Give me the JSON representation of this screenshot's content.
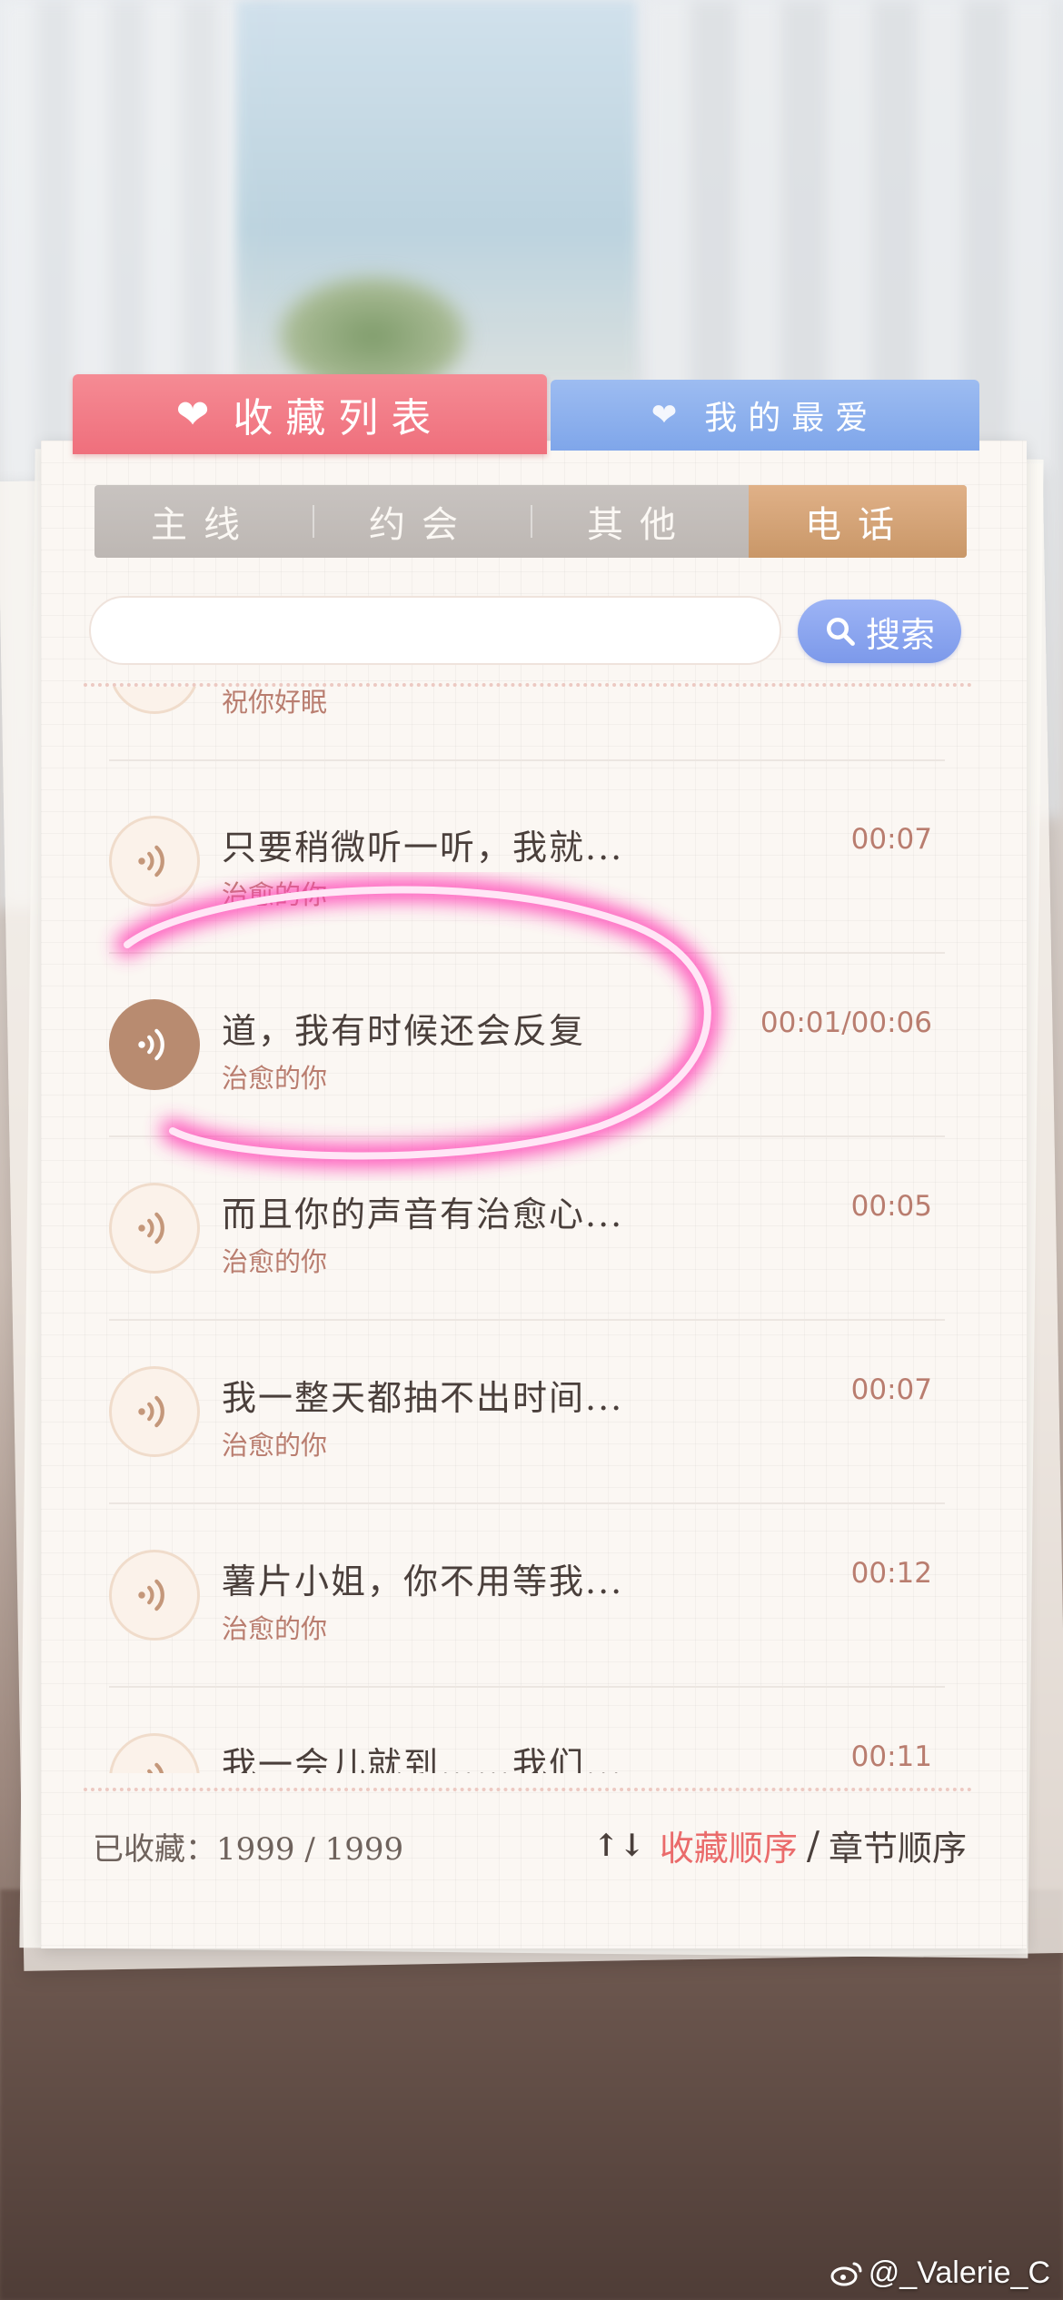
{
  "tabs": {
    "favorites": "收藏列表",
    "my_love": "我的最爱"
  },
  "categories": [
    "主线",
    "约会",
    "其他",
    "电话"
  ],
  "active_category": "电话",
  "search": {
    "placeholder": "",
    "button_label": "搜索"
  },
  "list": [
    {
      "title": "",
      "subtitle": "祝你好眠",
      "duration": ""
    },
    {
      "title": "只要稍微听一听，我就...",
      "subtitle": "治愈的你",
      "duration": "00:07"
    },
    {
      "title": "道，我有时候还会反复",
      "subtitle": "治愈的你",
      "duration": "00:01/00:06",
      "playing": true
    },
    {
      "title": "而且你的声音有治愈心...",
      "subtitle": "治愈的你",
      "duration": "00:05"
    },
    {
      "title": "我一整天都抽不出时间...",
      "subtitle": "治愈的你",
      "duration": "00:07"
    },
    {
      "title": "薯片小姐，你不用等我...",
      "subtitle": "治愈的你",
      "duration": "00:12"
    },
    {
      "title": "我一会儿就到……我们...",
      "subtitle": "",
      "duration": "00:11"
    }
  ],
  "footer": {
    "count_label": "已收藏：",
    "count_value": "1999 / 1999",
    "sort_active": "收藏顺序",
    "sort_separator": "/",
    "sort_other": "章节顺序"
  },
  "watermark": "@_Valerie_C",
  "colors": {
    "accent_pink": "#ef6f7c",
    "accent_blue": "#7fa6ea",
    "active_tab": "#c99768",
    "subtitle": "#b97d6f"
  }
}
